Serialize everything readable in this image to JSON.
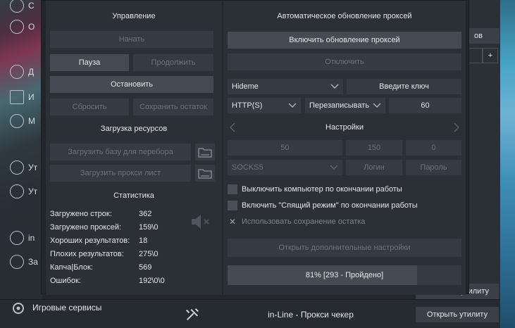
{
  "left_panel": {
    "section_control": "Управление",
    "btn_start": "Начать",
    "btn_pause": "Пауза",
    "btn_continue": "Продолжить",
    "btn_stop": "Остановить",
    "btn_reset": "Сбросить",
    "btn_save_rest": "Сохранить остаток",
    "section_load": "Загрузка ресурсов",
    "btn_load_base": "Загрузить базу для перебора",
    "btn_load_proxy": "Загрузить прокси лист",
    "section_stats": "Статистика",
    "stats": [
      {
        "label": "Загружено строк:",
        "value": "362"
      },
      {
        "label": "Загружено проксей:",
        "value": "159\\0"
      },
      {
        "label": "Хороших результатов:",
        "value": "18"
      },
      {
        "label": "Плохих результатов:",
        "value": "275\\0"
      },
      {
        "label": "Капча|Блок:",
        "value": "569"
      },
      {
        "label": "Ошибок:",
        "value": "192\\0\\0"
      }
    ]
  },
  "right_panel": {
    "section_auto": "Автоматическое обновление проксей",
    "btn_enable_update": "Включить обновление проксей",
    "btn_disable": "Отключить",
    "provider_select": "Hideme",
    "btn_enter_key": "Введите ключ",
    "protocol_select": "HTTP(S)",
    "mode_select": "Перезаписывать",
    "interval_value": "60",
    "section_settings": "Настройки",
    "threads": "50",
    "timeout": "150",
    "retries": "0",
    "socks_select": "SOCKS5",
    "login_placeholder": "Логин",
    "password_placeholder": "Пароль",
    "cb_shutdown": "Выключить компьютер по окончании работы",
    "cb_sleep": "Включить \"Спящий режим\" по окончании работы",
    "cb_save_rest": "Использовать сохранение остатка",
    "btn_more_settings": "Открыть дополнительные настройки",
    "progress_label": "81% [293 - Пройдено]",
    "progress_fraction": 0.81
  },
  "background": {
    "sidebar_labels": [
      "С",
      "О",
      "Д",
      "И",
      "М",
      "Ут",
      "Ут",
      "in",
      "За"
    ],
    "bottom_left_label": "Игровые сервисы",
    "bottom_title": "in-Line - Прокси чекер",
    "open_util": "Открыть утилиту",
    "peek_open_util": "утилиту",
    "peek_top_btn": "ов",
    "peek_plus": "+"
  }
}
